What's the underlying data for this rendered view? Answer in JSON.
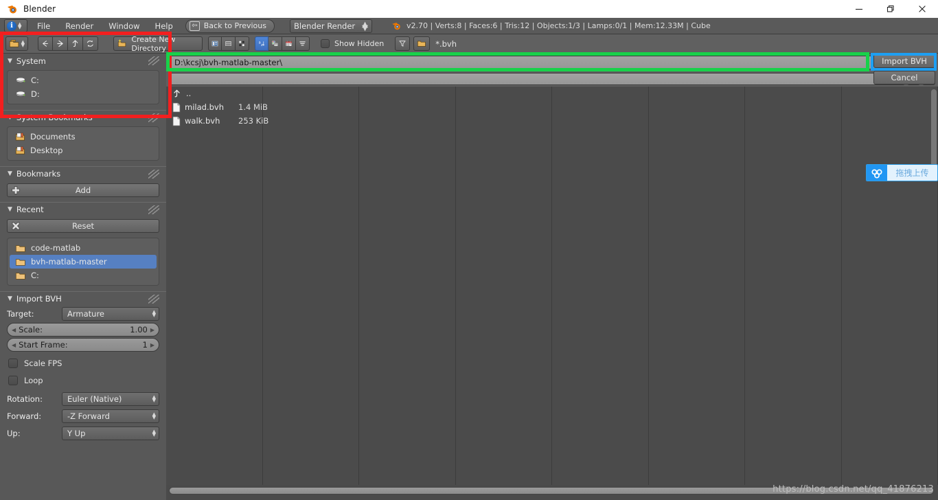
{
  "window": {
    "title": "Blender",
    "logo_icon": "blender-logo-icon",
    "minimize_icon": "minimize-icon",
    "maximize_icon": "restore-icon",
    "close_icon": "close-icon"
  },
  "topbar": {
    "editor_type_icon": "info-editor-icon",
    "menus": [
      "File",
      "Render",
      "Window",
      "Help"
    ],
    "back_to_previous": "Back to Previous",
    "back_icon": "back-arrow-icon",
    "render_engine": "Blender Render",
    "scene_icon": "blender-scene-icon",
    "status": "v2.70 | Verts:8 | Faces:6 | Tris:12 | Objects:1/3 | Lamps:0/1 | Mem:12.33M | Cube"
  },
  "file_toolbar": {
    "editor_type_icon": "file-browser-editor-icon",
    "nav_back_icon": "arrow-left-icon",
    "nav_forward_icon": "arrow-right-icon",
    "nav_parent_icon": "arrow-up-icon",
    "nav_refresh_icon": "refresh-icon",
    "create_new_directory": "Create New Directory",
    "create_dir_icon": "new-folder-icon",
    "display_modes": [
      "thumbnail-display-icon",
      "list-display-icon",
      "short-list-display-icon"
    ],
    "sort_modes": [
      "sort-alphabetical-icon",
      "sort-extension-icon",
      "sort-date-icon",
      "sort-size-icon"
    ],
    "show_hidden_label": "Show Hidden",
    "show_hidden_checked": false,
    "filter_toggle_icon": "funnel-filter-icon",
    "filter_folder_icon": "folder-filter-icon",
    "filter_extension": "*.bvh"
  },
  "path": {
    "value": "D:\\kcsj\\bvh-matlab-master\\",
    "filter_value": "",
    "decrement_label": "−",
    "increment_label": "+"
  },
  "actions": {
    "confirm": "Import BVH",
    "cancel": "Cancel"
  },
  "sidebar": {
    "panels": [
      {
        "title": "System",
        "items": [
          {
            "label": "C:",
            "icon": "disc-drive-icon",
            "selected": false
          },
          {
            "label": "D:",
            "icon": "disc-drive-icon",
            "selected": false
          }
        ]
      },
      {
        "title": "System Bookmarks",
        "items": [
          {
            "label": "Documents",
            "icon": "bookmark-folder-icon",
            "selected": false
          },
          {
            "label": "Desktop",
            "icon": "bookmark-folder-icon",
            "selected": false
          }
        ]
      },
      {
        "title": "Bookmarks",
        "button": {
          "label": "Add",
          "icon": "plus-icon"
        },
        "items": []
      },
      {
        "title": "Recent",
        "button": {
          "label": "Reset",
          "icon": "x-cross-icon"
        },
        "items": [
          {
            "label": "code-matlab",
            "icon": "folder-icon",
            "selected": false
          },
          {
            "label": "bvh-matlab-master",
            "icon": "folder-icon",
            "selected": true
          },
          {
            "label": "C:",
            "icon": "folder-icon",
            "selected": false
          }
        ]
      }
    ],
    "import_panel": {
      "title": "Import BVH",
      "target_label": "Target:",
      "target_value": "Armature",
      "scale_label": "Scale:",
      "scale_value": "1.00",
      "start_frame_label": "Start Frame:",
      "start_frame_value": "1",
      "scale_fps_label": "Scale FPS",
      "scale_fps_checked": false,
      "loop_label": "Loop",
      "loop_checked": false,
      "rotation_label": "Rotation:",
      "rotation_value": "Euler (Native)",
      "forward_label": "Forward:",
      "forward_value": "-Z Forward",
      "up_label": "Up:",
      "up_value": "Y Up"
    }
  },
  "file_list": {
    "parent_entry": "..",
    "parent_icon": "parent-directory-icon",
    "files": [
      {
        "name": "milad.bvh",
        "size": "1.4 MiB",
        "icon": "document-file-icon"
      },
      {
        "name": "walk.bvh",
        "size": "253 KiB",
        "icon": "document-file-icon"
      }
    ]
  },
  "netdisk_widget": {
    "logo_icon": "baidu-netdisk-icon",
    "label": "拖拽上传"
  },
  "watermark": "https://blog.csdn.net/qq_41876213",
  "annotation_colors": {
    "red": "#f21f1f",
    "green": "#18d14a",
    "blue": "#1e9ff2"
  }
}
